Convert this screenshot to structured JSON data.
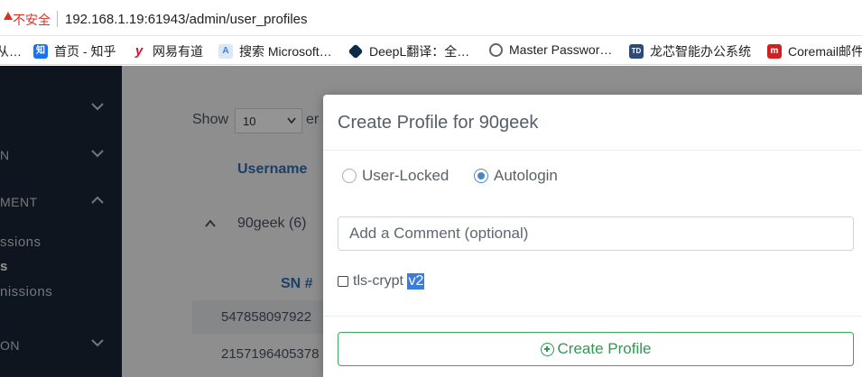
{
  "addressbar": {
    "security_label": "不安全",
    "url": "192.168.1.19:61943/admin/user_profiles"
  },
  "bookmarks": [
    {
      "label": "从…",
      "icon": "bookmark-icon",
      "color": "#888888"
    },
    {
      "label": "首页 - 知乎",
      "icon": "zhihu-icon",
      "color": "#1772f6"
    },
    {
      "label": "网易有道",
      "icon": "youdao-icon",
      "color": "#e0102f"
    },
    {
      "label": "搜索 Microsoft…",
      "icon": "microsoft-search-icon",
      "color": "#4a7bd0"
    },
    {
      "label": "DeepL翻译：全…",
      "icon": "deepl-icon",
      "color": "#0f2b46"
    },
    {
      "label": "Master Passwor…",
      "icon": "globe-icon",
      "color": "#5f6368"
    },
    {
      "label": "龙芯智能办公系统",
      "icon": "loongson-icon",
      "color": "#2c4a7a"
    },
    {
      "label": "Coremail邮件",
      "icon": "coremail-icon",
      "color": "#d02020"
    }
  ],
  "sidebar": {
    "items": [
      {
        "label": "N"
      },
      {
        "label": "MENT"
      },
      {
        "label": "ssions"
      },
      {
        "label": "s"
      },
      {
        "label": "nissions"
      },
      {
        "label": "ON"
      }
    ]
  },
  "content": {
    "show_label": "Show",
    "show_value": "10",
    "show_suffix": "er",
    "username_header": "Username",
    "group_label": "90geek (6)",
    "sn_header": "SN #",
    "rows": [
      "547858097922",
      "2157196405378"
    ]
  },
  "modal": {
    "title": "Create Profile for 90geek",
    "radio_user_locked": "User-Locked",
    "radio_autologin": "Autologin",
    "selected_radio": "Autologin",
    "comment_placeholder": "Add a Comment (optional)",
    "tls_label": "tls-crypt",
    "tls_selected_suffix": "v2",
    "create_button": "Create Profile"
  }
}
